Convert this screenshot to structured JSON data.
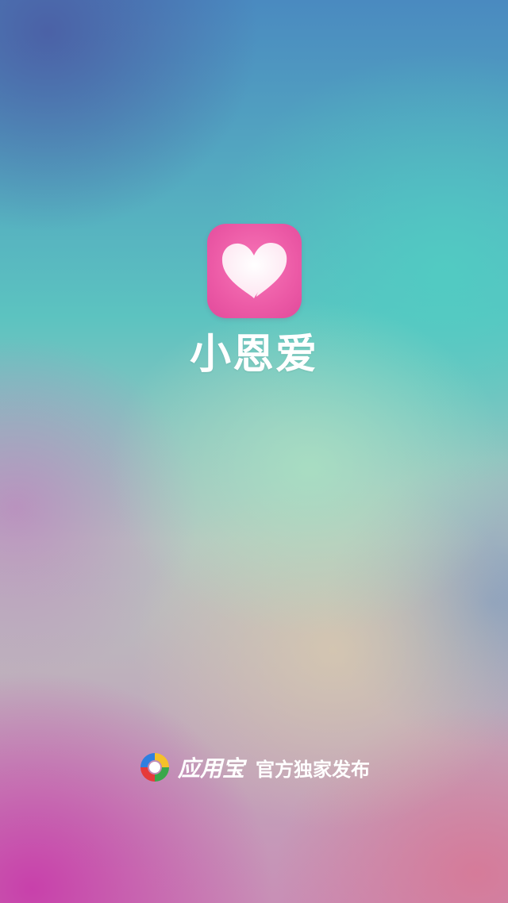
{
  "app": {
    "name": "小恩爱",
    "icon": "heart-icon",
    "icon_color": "#ec5aa6"
  },
  "footer": {
    "store_logo": "app-store-logo-icon",
    "store_name": "应用宝",
    "slogan": "官方独家发布"
  }
}
